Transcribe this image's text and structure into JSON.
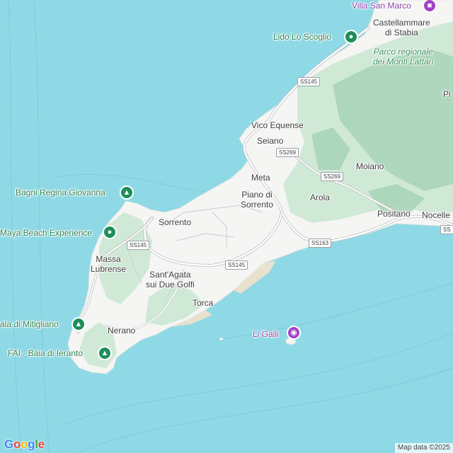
{
  "map": {
    "colors": {
      "sea": "#8fd9e6",
      "land": "#f5f5f3",
      "vegetation": "#cfe9d6",
      "mountain": "#a8d4b8",
      "road": "#ffffff",
      "road_edge": "#b8bcc0"
    },
    "places": {
      "castellammare": "Castellammare\ndi Stabia",
      "vico_equense": "Vico Equense",
      "seiano": "Seiano",
      "meta": "Meta",
      "piano": "Piano di\nSorrento",
      "moiano": "Moiano",
      "arola": "Arola",
      "positano": "Positano",
      "nocelle": "Nocelle",
      "pi_cut": "Pi",
      "sorrento": "Sorrento",
      "massa_lubrense": "Massa\nLubrense",
      "santagata": "Sant'Agata\nsui Due Golfi",
      "torca": "Torca",
      "nerano": "Nerano"
    },
    "park": "Parco regionale\ndei Monti Lattari",
    "pois": {
      "villa_san_marco": "Villa San Marco",
      "lido": "Lido Lo Scoglio",
      "bagni": "Bagni Regina Giovanna",
      "maya": "Maya Beach Experience",
      "mitigliano": "ala di Mitigliano",
      "ieranto": "FAI - Baia di Ieranto",
      "li_galli": "Li Galli"
    },
    "roads": {
      "ss145_top": "SS145",
      "ss269_seiano": "SS269",
      "ss269_arola": "SS269",
      "ss145_left": "SS145",
      "ss145_mid": "SS145",
      "ss163": "SS163",
      "ss_right": "SS"
    },
    "google_logo": [
      "G",
      "o",
      "o",
      "g",
      "l",
      "e"
    ],
    "attribution": "Map data ©2025"
  }
}
